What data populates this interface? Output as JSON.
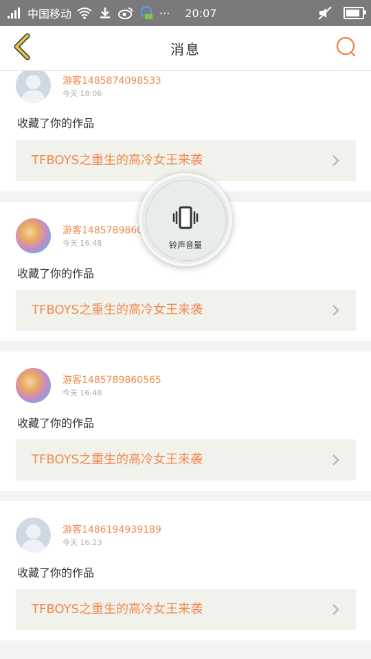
{
  "status_bar": {
    "carrier": "中国移动",
    "time": "20:07",
    "icons": [
      "signal-icon",
      "wifi-icon",
      "download-icon",
      "weibo-icon",
      "notification-icon",
      "more-icon",
      "mute-icon",
      "battery-icon"
    ],
    "battery_level": 0.85,
    "more_text": "···"
  },
  "navbar": {
    "title": "消息",
    "back_icon": "chevron-left-icon",
    "search_icon": "search-icon",
    "accent": "#f08a4f",
    "back_color": "#e6c44a"
  },
  "messages": [
    {
      "username": "游客1485874098533",
      "time": "今天 18:06",
      "action": "收藏了你的作品",
      "work_title": "TFBOYS之重生的高冷女王来袭",
      "avatar": "default"
    },
    {
      "username": "游客1485789860",
      "time": "今天 16:48",
      "action": "收藏了你的作品",
      "work_title": "TFBOYS之重生的高冷女王来袭",
      "avatar": "anime"
    },
    {
      "username": "游客1485789860565",
      "time": "今天 16:48",
      "action": "收藏了你的作品",
      "work_title": "TFBOYS之重生的高冷女王来袭",
      "avatar": "anime"
    },
    {
      "username": "游客1486194939189",
      "time": "今天 16:23",
      "action": "收藏了你的作品",
      "work_title": "TFBOYS之重生的高冷女王来袭",
      "avatar": "default"
    }
  ],
  "overlay": {
    "label": "铃声音量",
    "icon": "vibrate-icon"
  },
  "colors": {
    "accent": "#f08a4f",
    "status_bar": "#7a7a7a",
    "card_bg": "#ffffff",
    "work_bg": "#f2f2ec"
  }
}
